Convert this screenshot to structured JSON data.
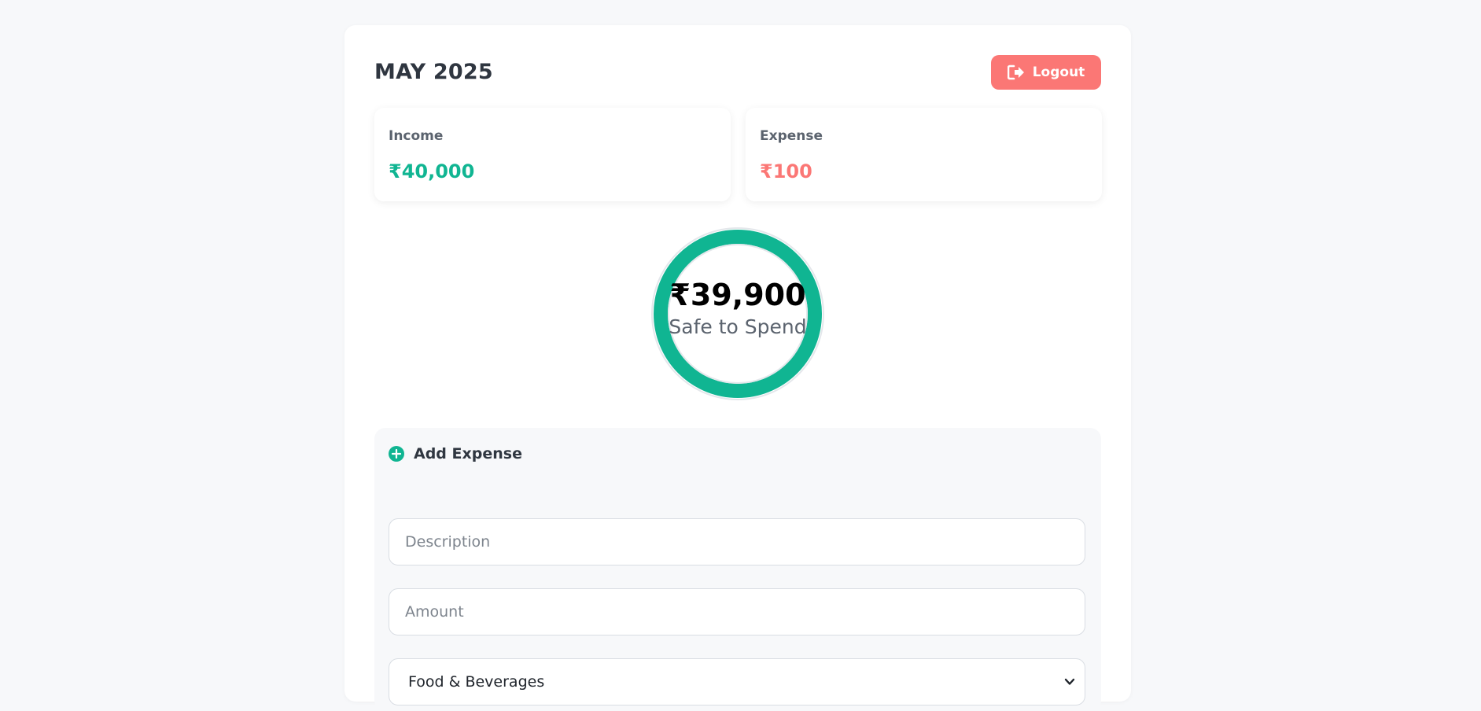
{
  "header": {
    "month": "MAY 2025",
    "logout_label": "Logout"
  },
  "summary": {
    "income_label": "Income",
    "income_value": "₹40,000",
    "expense_label": "Expense",
    "expense_value": "₹100"
  },
  "safe_to_spend": {
    "amount": "₹39,900",
    "caption": "Safe to Spend"
  },
  "add_expense": {
    "title": "Add Expense",
    "description_placeholder": "Description",
    "amount_placeholder": "Amount",
    "category_selected": "Food & Beverages"
  },
  "colors": {
    "accent_green": "#10b592",
    "accent_red": "#fb7775",
    "background": "#f7f8fa"
  },
  "icons": {
    "logout": "logout-icon",
    "add": "plus-circle-icon",
    "select": "chevron-down-icon"
  }
}
